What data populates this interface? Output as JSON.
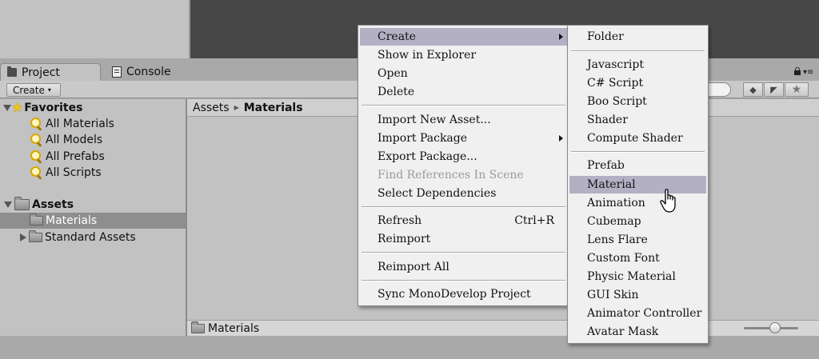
{
  "tabs": {
    "project": "Project",
    "console": "Console"
  },
  "toolbar": {
    "create_label": "Create"
  },
  "breadcrumb": {
    "root": "Assets",
    "current": "Materials"
  },
  "tree": {
    "favorites_label": "Favorites",
    "favorites_items": [
      "All Materials",
      "All Models",
      "All Prefabs",
      "All Scripts"
    ],
    "assets_label": "Assets",
    "assets_items": [
      "Materials",
      "Standard Assets"
    ]
  },
  "status": {
    "path": "Materials"
  },
  "main_menu": {
    "items": [
      "Create",
      "Show in Explorer",
      "Open",
      "Delete",
      "Import New Asset...",
      "Import Package",
      "Export Package...",
      "Find References In Scene",
      "Select Dependencies",
      "Refresh",
      "Reimport",
      "Reimport All",
      "Sync MonoDevelop Project"
    ],
    "refresh_shortcut": "Ctrl+R"
  },
  "sub_menu": {
    "items": [
      "Folder",
      "Javascript",
      "C# Script",
      "Boo Script",
      "Shader",
      "Compute Shader",
      "Prefab",
      "Material",
      "Animation",
      "Cubemap",
      "Lens Flare",
      "Custom Font",
      "Physic Material",
      "GUI Skin",
      "Animator Controller",
      "Avatar Mask"
    ]
  },
  "colors": {
    "highlight": "#b3b0c4",
    "selection": "#8e8e8e",
    "scene_view": "#474747"
  }
}
